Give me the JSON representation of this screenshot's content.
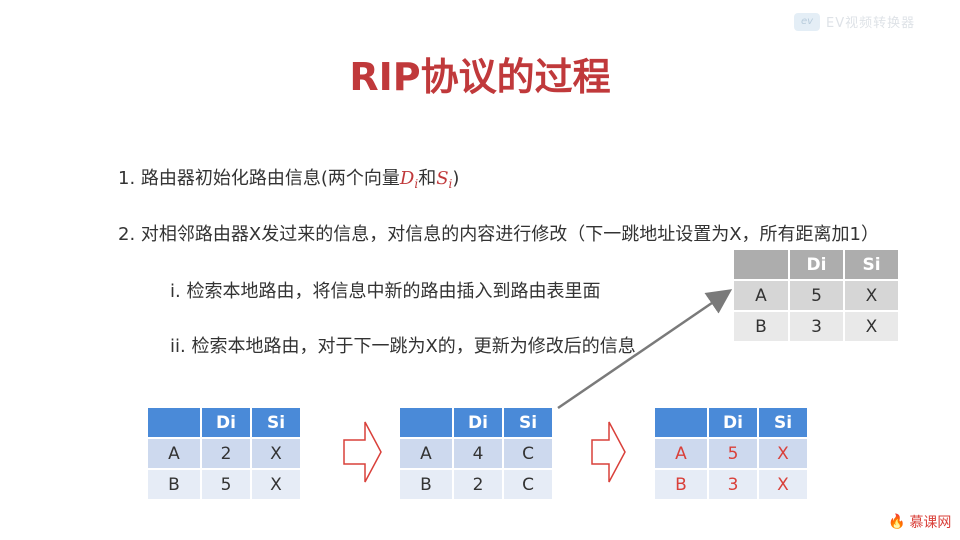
{
  "watermark": {
    "logo": "ev",
    "text": "EV视频转换器"
  },
  "title": "RIP协议的过程",
  "steps": {
    "s1": "1. 路由器初始化路由信息(两个向量",
    "s1_d": "D",
    "s1_d_sub": "i",
    "s1_and": "和",
    "s1_s": "S",
    "s1_s_sub": "i",
    "s1_close": ")",
    "s2": "2. 对相邻路由器X发过来的信息，对信息的内容进行修改（下一跳地址设置为X，所有距离加1）",
    "s3": "i. 检索本地路由，将信息中新的路由插入到路由表里面",
    "s4": "ii. 检索本地路由，对于下一跳为X的，更新为修改后的信息"
  },
  "tables": {
    "modified": {
      "headers": [
        "",
        "Di",
        "Si"
      ],
      "rows": [
        [
          "A",
          "5",
          "X"
        ],
        [
          "B",
          "3",
          "X"
        ]
      ]
    },
    "t1": {
      "headers": [
        "",
        "Di",
        "Si"
      ],
      "rows": [
        [
          "A",
          "2",
          "X"
        ],
        [
          "B",
          "5",
          "X"
        ]
      ]
    },
    "t2": {
      "headers": [
        "",
        "Di",
        "Si"
      ],
      "rows": [
        [
          "A",
          "4",
          "C"
        ],
        [
          "B",
          "2",
          "C"
        ]
      ]
    },
    "t3": {
      "headers": [
        "",
        "Di",
        "Si"
      ],
      "rows": [
        [
          "A",
          "5",
          "X"
        ],
        [
          "B",
          "3",
          "X"
        ]
      ]
    }
  },
  "colors": {
    "title": "#c0393b",
    "header": "#4a8ad8",
    "updated": "#d9403a"
  },
  "brand": {
    "text": "慕课网",
    "icon": "flame-icon"
  }
}
